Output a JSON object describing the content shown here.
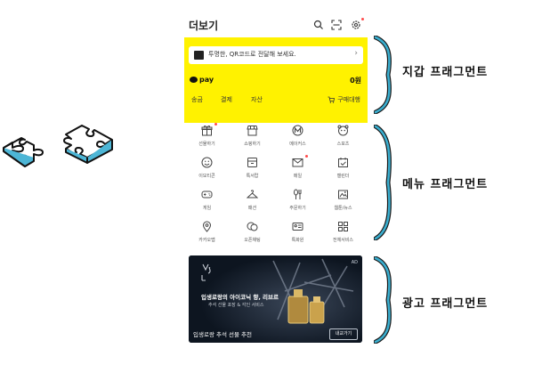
{
  "screen": {
    "title": "더보기",
    "top_icons": [
      "search-icon",
      "qr-scan-icon",
      "settings-icon"
    ]
  },
  "wallet": {
    "qr_notice": "투명한, QR코드로 전달해 보세요.",
    "pay_brand": "pay",
    "balance": "0원",
    "links": [
      "송금",
      "결제",
      "자산"
    ],
    "cart_label": "구매대행",
    "background_color": "#fff200"
  },
  "menu": {
    "items": [
      {
        "label": "선물하기",
        "icon": "gift-icon",
        "new": true
      },
      {
        "label": "쇼핑하기",
        "icon": "store-icon",
        "new": false
      },
      {
        "label": "메이커스",
        "icon": "makers-icon",
        "new": false
      },
      {
        "label": "스포츠",
        "icon": "sports-icon",
        "new": false
      },
      {
        "label": "이모티콘",
        "icon": "emoticon-icon",
        "new": false
      },
      {
        "label": "톡서랍",
        "icon": "drawer-icon",
        "new": false
      },
      {
        "label": "메일",
        "icon": "mail-icon",
        "new": true
      },
      {
        "label": "캘린더",
        "icon": "calendar-icon",
        "new": false
      },
      {
        "label": "게임",
        "icon": "game-icon",
        "new": false
      },
      {
        "label": "패션",
        "icon": "hanger-icon",
        "new": false
      },
      {
        "label": "주문하기",
        "icon": "order-icon",
        "new": false
      },
      {
        "label": "웹툰/뉴스",
        "icon": "webtoon-icon",
        "new": false
      },
      {
        "label": "카카오맵",
        "icon": "map-pin-icon",
        "new": false
      },
      {
        "label": "오픈채팅",
        "icon": "open-chat-icon",
        "new": false
      },
      {
        "label": "톡화원",
        "icon": "id-card-icon",
        "new": false
      },
      {
        "label": "전체서비스",
        "icon": "all-services-icon",
        "new": false
      }
    ]
  },
  "ad": {
    "badge": "AD",
    "headline": "입생로랑의 아이코닉 향, 리브르",
    "subline": "추석 선물 포장 & 각인 서비스",
    "caption": "입생로랑 추석 선물 추천",
    "cta": "내교가기"
  },
  "fragments": [
    {
      "label": "지갑 프래그먼트",
      "color": "#3aaecf"
    },
    {
      "label": "메뉴 프래그먼트",
      "color": "#3aaecf"
    },
    {
      "label": "광고 프래그먼트",
      "color": "#3aaecf"
    }
  ]
}
